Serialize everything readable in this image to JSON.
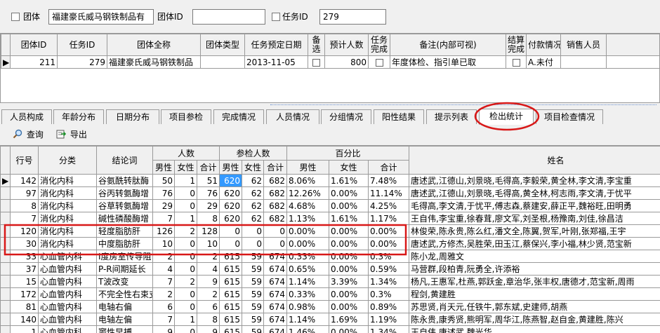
{
  "filter": {
    "group_label": "团体",
    "group_value": "福建豪氏威马钢铁制品有",
    "group_id_label": "团体ID",
    "group_id_value": "",
    "task_id_label": "任务ID",
    "task_id_value": "279"
  },
  "top_grid": {
    "headers": [
      "团体ID",
      "任务ID",
      "团体全称",
      "团体类型",
      "任务预定日期",
      "备选",
      "预计人数",
      "任务完成",
      "备注(内部可视)",
      "结算完成",
      "付款情况",
      "销售人员"
    ],
    "row": {
      "group_id": "211",
      "task_id": "279",
      "group_name": "福建豪氏威马钢铁制品",
      "group_type": "",
      "date": "2013-11-05",
      "people": "800",
      "remark": "年度体检、指引单已取",
      "payment": "A.未付"
    }
  },
  "tabs": [
    "人员构成",
    "年龄分布",
    "日期分布",
    "项目参检",
    "完成情况",
    "人员情况",
    "分组情况",
    "阳性结果",
    "提示列表",
    "检出统计",
    "项目检查情况"
  ],
  "active_tab": "检出统计",
  "toolbar": {
    "query": "查询",
    "export": "导出"
  },
  "grid": {
    "headers": {
      "row": "行号",
      "category": "分类",
      "conclusion": "结论词",
      "count": "人数",
      "exam_count": "参检人数",
      "percent": "百分比",
      "name": "姓名",
      "male": "男性",
      "female": "女性",
      "total": "合计"
    },
    "rows": [
      [
        "142",
        "消化内科",
        "谷氨酰转肽酶",
        "50",
        "1",
        "51",
        "620",
        "62",
        "682",
        "8.06%",
        "1.61%",
        "7.48%",
        "唐述武,江德山,刘景晓,毛得高,李毅荣,黄全林,李文清,李宝重"
      ],
      [
        "97",
        "消化内科",
        "谷丙转氨酶增",
        "76",
        "0",
        "76",
        "620",
        "62",
        "682",
        "12.26%",
        "0.00%",
        "11.14%",
        "唐述武,江德山,刘景晓,毛得高,黄全林,柯志雨,李文清,于忧平"
      ],
      [
        "8",
        "消化内科",
        "谷草转氨酶增",
        "29",
        "0",
        "29",
        "620",
        "62",
        "682",
        "4.68%",
        "0.00%",
        "4.25%",
        "毛得高,李文清,于忧平,傅志森,蔡建安,薛正平,魏裕旺,田明勇"
      ],
      [
        "7",
        "消化内科",
        "碱性磷酸酶增",
        "7",
        "1",
        "8",
        "620",
        "62",
        "682",
        "1.13%",
        "1.61%",
        "1.17%",
        "王自伟,李宝重,徐春茸,廖文军,刘圣根,杨豫南,刘佳,徐昌洁"
      ],
      [
        "120",
        "消化内科",
        "轻度脂肪肝",
        "126",
        "2",
        "128",
        "0",
        "0",
        "0",
        "0.00%",
        "0.00%",
        "0.00%",
        "林俊荣,陈永贵,陈么红,潘文全,陈翼,贺军,叶刚,张郑福,王宇"
      ],
      [
        "30",
        "消化内科",
        "中度脂肪肝",
        "10",
        "0",
        "10",
        "0",
        "0",
        "0",
        "0.00%",
        "0.00%",
        "0.00%",
        "唐述武,方修杰,吴胜荣,田玉江,蔡保兴,李小福,林少贤,范宝新"
      ],
      [
        "33",
        "心血管内科",
        "I度房室传导阻",
        "2",
        "0",
        "2",
        "615",
        "59",
        "674",
        "0.33%",
        "0.00%",
        "0.3%",
        "陈小龙,周雅文"
      ],
      [
        "37",
        "心血管内科",
        "P-R间期延长",
        "4",
        "0",
        "4",
        "615",
        "59",
        "674",
        "0.65%",
        "0.00%",
        "0.59%",
        "马营群,段柏青,阮勇全,许添裕"
      ],
      [
        "15",
        "心血管内科",
        "T波改变",
        "7",
        "2",
        "9",
        "615",
        "59",
        "674",
        "1.14%",
        "3.39%",
        "1.34%",
        "杨凡,王惠军,杜燕,郭跃金,章治华,张丰权,唐德才,范宝新,周雨"
      ],
      [
        "172",
        "心血管内科",
        "不完全性右束支",
        "2",
        "0",
        "2",
        "615",
        "59",
        "674",
        "0.33%",
        "0.00%",
        "0.3%",
        "程剑,黄建胜"
      ],
      [
        "81",
        "心血管内科",
        "电轴右偏",
        "6",
        "0",
        "6",
        "615",
        "59",
        "674",
        "0.98%",
        "0.00%",
        "0.89%",
        "苏思贤,肖天元,任铁牛,郭东斌,史建师,胡燕"
      ],
      [
        "140",
        "心血管内科",
        "电轴左偏",
        "7",
        "1",
        "8",
        "615",
        "59",
        "674",
        "1.14%",
        "1.69%",
        "1.19%",
        "陈永贵,康秀贤,熊明军,周华江,陈燕智,赵自金,黄建胜,陈兴"
      ],
      [
        "1",
        "心血管内科",
        "窦性早搏",
        "9",
        "0",
        "9",
        "615",
        "59",
        "674",
        "1.46%",
        "0.00%",
        "1.34%",
        "王自伟,唐述武,魏光华"
      ]
    ]
  },
  "colors": {
    "selected_cell": "#3399ff",
    "annotation": "#d81818"
  }
}
